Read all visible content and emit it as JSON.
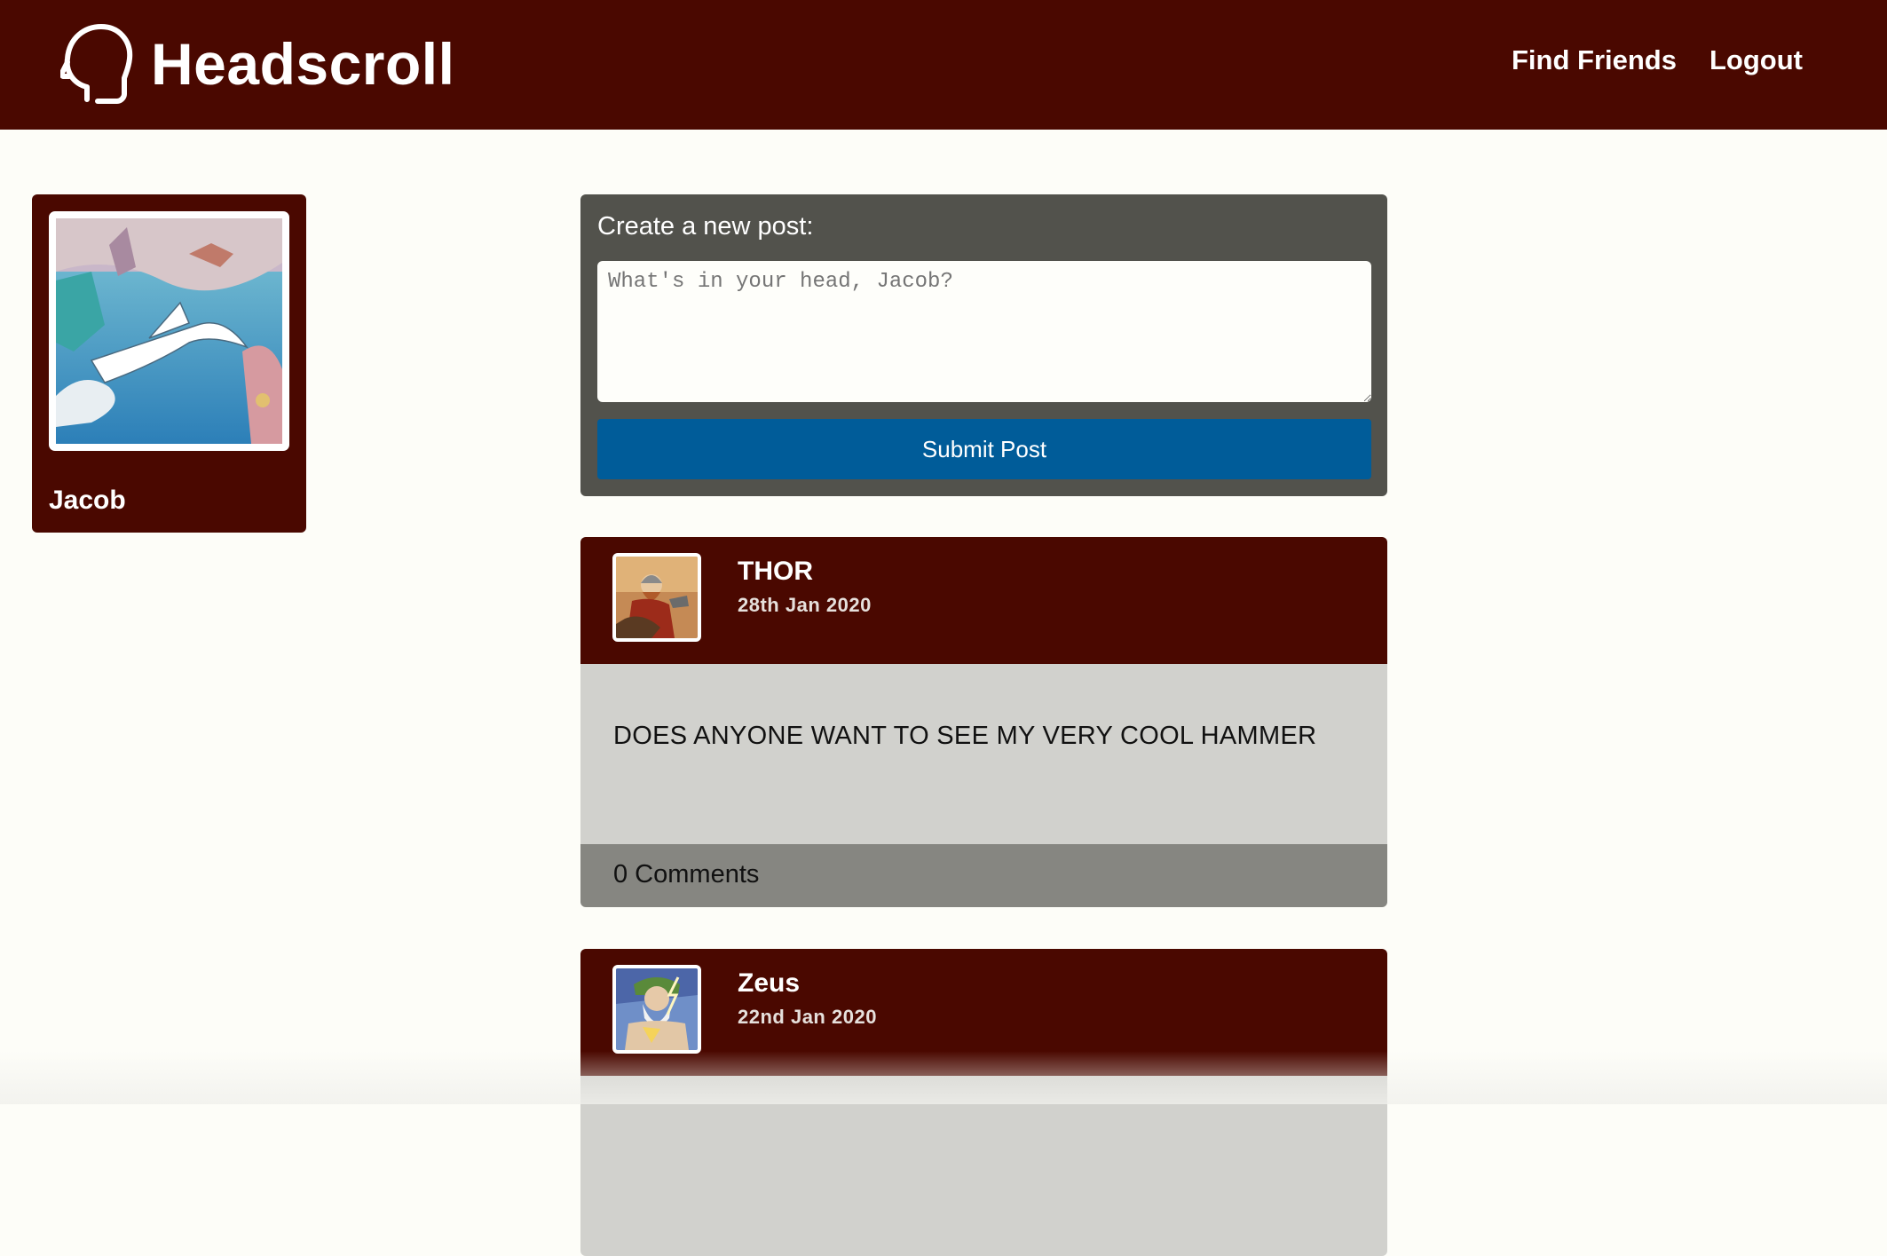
{
  "navbar": {
    "brand": "Headscroll",
    "links": [
      "Find Friends",
      "Logout"
    ]
  },
  "profile": {
    "name": "Jacob"
  },
  "composer": {
    "label": "Create a new post:",
    "placeholder": "What's in your head, Jacob?",
    "submit_label": "Submit Post"
  },
  "posts": [
    {
      "author": "THOR",
      "date": "28th Jan 2020",
      "text": "DOES ANYONE WANT TO SEE MY VERY COOL HAMMER",
      "comments": "0 Comments"
    },
    {
      "author": "Zeus",
      "date": "22nd Jan 2020"
    }
  ],
  "colors": {
    "brand": "#4a0800",
    "composer_bg": "#52524c",
    "submit": "#005c99",
    "post_body": "#d1d1cd",
    "post_footer": "#868681"
  }
}
